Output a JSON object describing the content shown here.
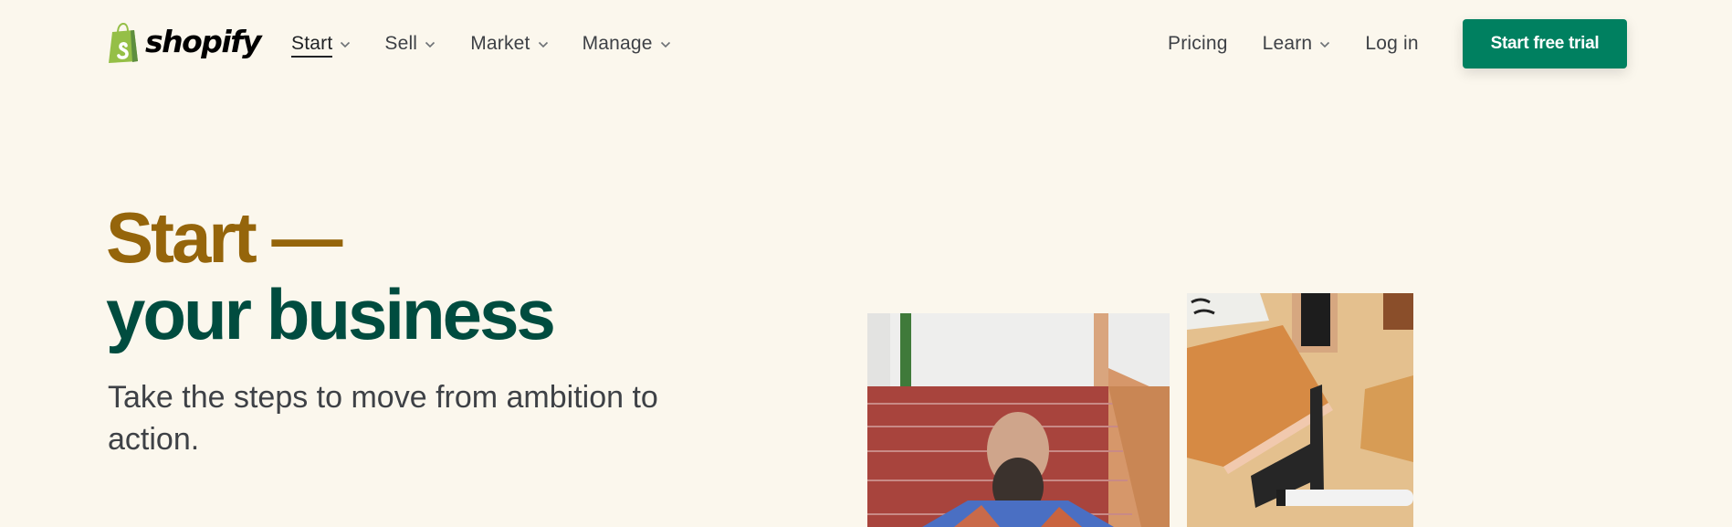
{
  "brand": {
    "name": "shopify",
    "logo_icon": "shopping-bag-icon",
    "logo_color": "#95bf47"
  },
  "nav": {
    "primary": [
      {
        "label": "Start",
        "has_dropdown": true,
        "active": true
      },
      {
        "label": "Sell",
        "has_dropdown": true,
        "active": false
      },
      {
        "label": "Market",
        "has_dropdown": true,
        "active": false
      },
      {
        "label": "Manage",
        "has_dropdown": true,
        "active": false
      }
    ],
    "secondary": [
      {
        "label": "Pricing",
        "has_dropdown": false
      },
      {
        "label": "Learn",
        "has_dropdown": true
      },
      {
        "label": "Log in",
        "has_dropdown": false
      }
    ],
    "cta_label": "Start free trial",
    "cta_color": "#008060"
  },
  "hero": {
    "title_line1": "Start —",
    "title_line2": "your business",
    "title_line1_color": "#95650b",
    "title_line2_color": "#004c3f",
    "subtitle": "Take the steps to move from ambition to action.",
    "images": [
      {
        "alt": "Bearded man sitting on red stairs"
      },
      {
        "alt": "Leather notebook, ruler and marker on wooden table"
      }
    ]
  }
}
